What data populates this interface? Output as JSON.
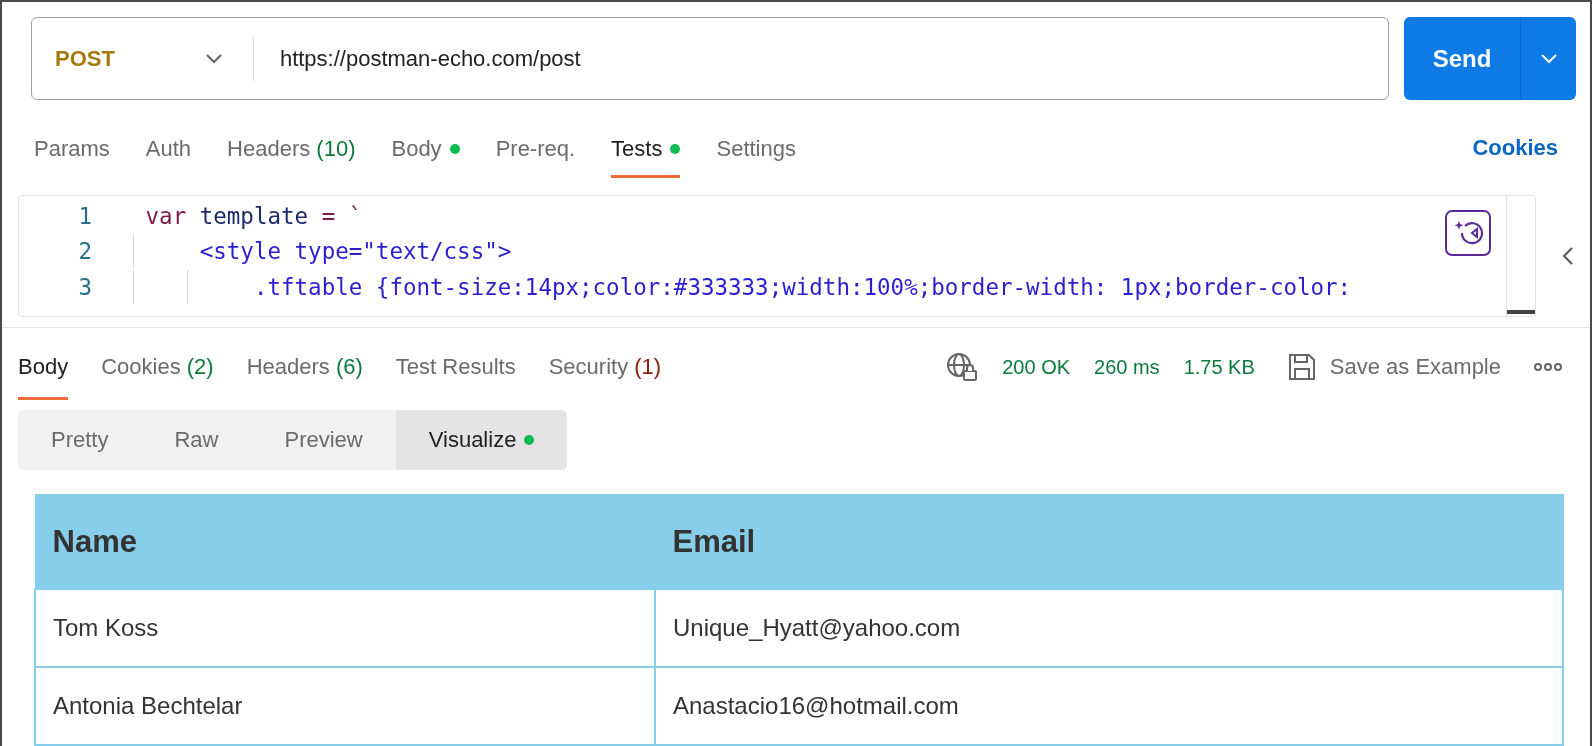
{
  "request": {
    "method": "POST",
    "url": "https://postman-echo.com/post",
    "send_label": "Send"
  },
  "request_tabs": [
    {
      "label": "Params",
      "selected": false,
      "dot": false
    },
    {
      "label": "Auth",
      "selected": false,
      "dot": false
    },
    {
      "label": "Headers",
      "count": "(10)",
      "color": "#0b7a3a",
      "selected": false,
      "dot": false
    },
    {
      "label": "Body",
      "selected": false,
      "dot": true
    },
    {
      "label": "Pre-req.",
      "selected": false,
      "dot": false
    },
    {
      "label": "Tests",
      "selected": true,
      "dot": true
    },
    {
      "label": "Settings",
      "selected": false,
      "dot": false
    }
  ],
  "cookies_link": "Cookies",
  "editor": {
    "lines": [
      {
        "number": "1",
        "tokens": [
          {
            "text": "var",
            "kind": "keyword"
          },
          {
            "text": " template ",
            "kind": "plain"
          },
          {
            "text": "=",
            "kind": "operator"
          },
          {
            "text": " `",
            "kind": "operator"
          }
        ]
      },
      {
        "number": "2",
        "tokens": [
          {
            "text": "    <style type=\"text/css\">",
            "kind": "string"
          }
        ]
      },
      {
        "number": "3",
        "tokens": [
          {
            "text": "        .tftable {font-size:14px;color:#333333;width:100%;border-width: 1px;border-color:",
            "kind": "string"
          }
        ]
      }
    ]
  },
  "response_tabs": [
    {
      "label": "Body",
      "selected": true
    },
    {
      "label": "Cookies",
      "count": "(2)",
      "color": "#0b7a3a",
      "selected": false
    },
    {
      "label": "Headers",
      "count": "(6)",
      "color": "#0b7a3a",
      "selected": false
    },
    {
      "label": "Test Results",
      "selected": false
    },
    {
      "label": "Security",
      "count": "(1)",
      "color": "#8e1a10",
      "selected": false
    }
  ],
  "response_stats": [
    "200 OK",
    "260 ms",
    "1.75 KB"
  ],
  "save_label": "Save as Example",
  "formats": [
    {
      "label": "Pretty",
      "selected": false,
      "dot": false
    },
    {
      "label": "Raw",
      "selected": false,
      "dot": false
    },
    {
      "label": "Preview",
      "selected": false,
      "dot": false
    },
    {
      "label": "Visualize",
      "selected": true,
      "dot": true
    }
  ],
  "table": {
    "columns": [
      "Name",
      "Email"
    ],
    "rows": [
      [
        "Tom Koss",
        "Unique_Hyatt@yahoo.com"
      ],
      [
        "Antonia Bechtelar",
        "Anastacio16@hotmail.com"
      ]
    ]
  }
}
